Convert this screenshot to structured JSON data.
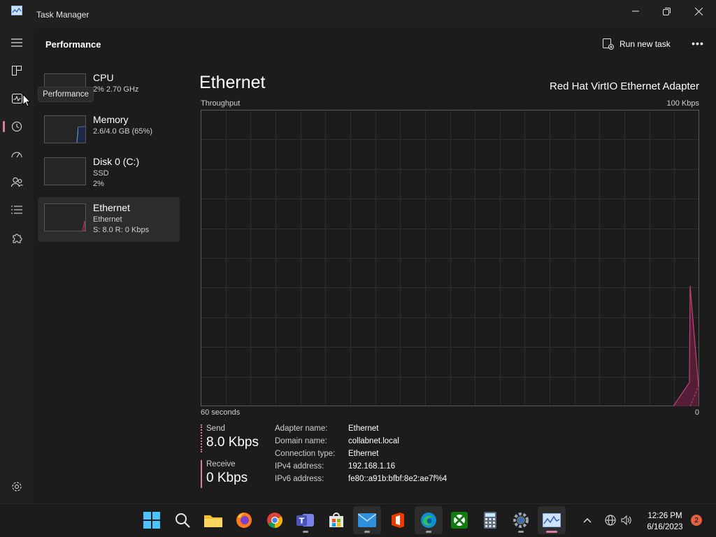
{
  "window": {
    "title": "Task Manager"
  },
  "header": {
    "page_title": "Performance",
    "run_task_label": "Run new task",
    "more_label": "•••"
  },
  "tooltip": {
    "text": "Performance"
  },
  "devices": [
    {
      "name": "CPU",
      "sub1": "2% 2.70 GHz",
      "sub2": ""
    },
    {
      "name": "Memory",
      "sub1": "2.6/4.0 GB (65%)",
      "sub2": ""
    },
    {
      "name": "Disk 0 (C:)",
      "sub1": "SSD",
      "sub2": "2%"
    },
    {
      "name": "Ethernet",
      "sub1": "Ethernet",
      "sub2": "S: 8.0 R: 0 Kbps"
    }
  ],
  "detail": {
    "title": "Ethernet",
    "adapter": "Red Hat VirtIO Ethernet Adapter",
    "graph_label": "Throughput",
    "scale_max": "100 Kbps",
    "time_span": "60 seconds",
    "scale_min": "0",
    "send_label": "Send",
    "send_value": "8.0 Kbps",
    "receive_label": "Receive",
    "receive_value": "0 Kbps",
    "properties": [
      {
        "key": "Adapter name:",
        "value": "Ethernet"
      },
      {
        "key": "Domain name:",
        "value": "collabnet.local"
      },
      {
        "key": "Connection type:",
        "value": "Ethernet"
      },
      {
        "key": "IPv4 address:",
        "value": "192.168.1.16"
      },
      {
        "key": "IPv6 address:",
        "value": "fe80::a91b:bfbf:8e2:ae7f%4"
      }
    ]
  },
  "taskbar": {
    "time": "12:26 PM",
    "date": "6/16/2023",
    "notifications": "2"
  },
  "colors": {
    "accent": "#e27aa7",
    "graph_fill": "#5a1f3a",
    "graph_line": "#c2437a",
    "grid": "#2e2e2e"
  }
}
